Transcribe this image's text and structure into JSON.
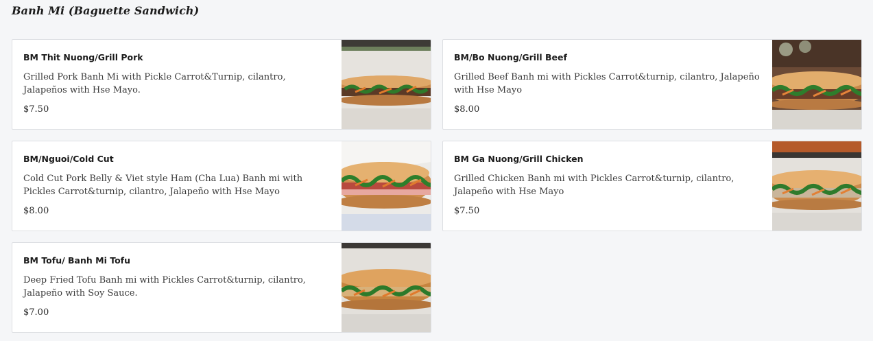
{
  "section": {
    "title": "Banh Mi (Baguette Sandwich)"
  },
  "items": [
    {
      "name": "BM Thit Nuong/Grill Pork",
      "description": "Grilled Pork Banh Mi with Pickle Carrot&Turnip, cilantro, Jalapeños with Hse Mayo.",
      "price": "$7.50",
      "image": "grilled-pork-banh-mi-photo"
    },
    {
      "name": "BM/Bo Nuong/Grill Beef",
      "description": "Grilled Beef Banh mi with Pickles Carrot&turnip, cilantro, Jalapeño with Hse Mayo",
      "price": "$8.00",
      "image": "grilled-beef-banh-mi-photo"
    },
    {
      "name": "BM/Nguoi/Cold Cut",
      "description": "Cold Cut Pork Belly & Viet style Ham (Cha Lua) Banh mi with Pickles Carrot&turnip, cilantro, Jalapeño with Hse Mayo",
      "price": "$8.00",
      "image": "cold-cut-banh-mi-photo"
    },
    {
      "name": "BM Ga Nuong/Grill Chicken",
      "description": "Grilled Chicken Banh mi with Pickles Carrot&turnip, cilantro, Jalapeño with Hse Mayo",
      "price": "$7.50",
      "image": "grilled-chicken-banh-mi-photo"
    },
    {
      "name": "BM Tofu/ Banh Mi Tofu",
      "description": "Deep Fried Tofu Banh mi with Pickles Carrot&turnip, cilantro, Jalapeño with Soy Sauce.",
      "price": "$7.00",
      "image": "tofu-banh-mi-photo"
    }
  ]
}
